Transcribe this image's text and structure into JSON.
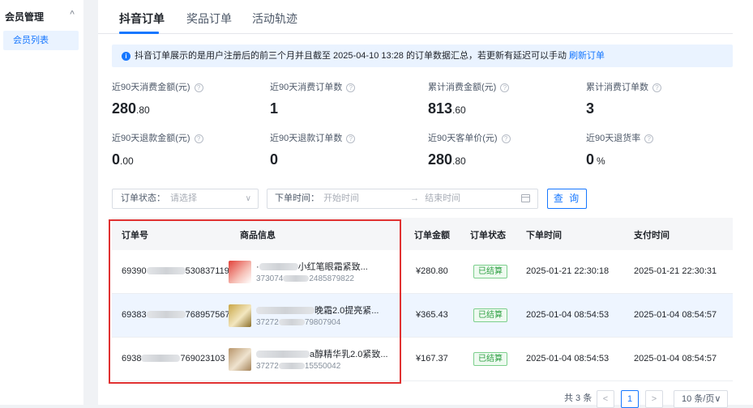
{
  "sidebar": {
    "group_label": "会员管理",
    "group_chevron": "^",
    "items": [
      {
        "label": "会员列表"
      }
    ]
  },
  "tabs": [
    {
      "label": "抖音订单"
    },
    {
      "label": "奖品订单"
    },
    {
      "label": "活动轨迹"
    }
  ],
  "notice": {
    "icon": "i",
    "text": "抖音订单展示的是用户注册后的前三个月并且截至 2025-04-10 13:28 的订单数据汇总，若更新有延迟可以手动 ",
    "link": "刷新订单"
  },
  "stats": [
    {
      "label": "近90天消费金额(元)",
      "int": "280",
      "dec": ".80",
      "unit": ""
    },
    {
      "label": "近90天消费订单数",
      "int": "1",
      "dec": "",
      "unit": ""
    },
    {
      "label": "累计消费金额(元)",
      "int": "813",
      "dec": ".60",
      "unit": ""
    },
    {
      "label": "累计消费订单数",
      "int": "3",
      "dec": "",
      "unit": ""
    },
    {
      "label": "近90天退款金额(元)",
      "int": "0",
      "dec": ".00",
      "unit": ""
    },
    {
      "label": "近90天退款订单数",
      "int": "0",
      "dec": "",
      "unit": ""
    },
    {
      "label": "近90天客单价(元)",
      "int": "280",
      "dec": ".80",
      "unit": ""
    },
    {
      "label": "近90天退货率",
      "int": "0",
      "dec": "",
      "unit": "%"
    }
  ],
  "help_glyph": "?",
  "filters": {
    "status_label": "订单状态：",
    "status_placeholder": "请选择",
    "status_chevron": "∨",
    "time_label": "下单时间：",
    "start_placeholder": "开始时间",
    "arrow": "→",
    "end_placeholder": "结束时间",
    "query_button": "查 询"
  },
  "table": {
    "columns": [
      "订单号",
      "商品信息",
      "订单金额",
      "订单状态",
      "下单时间",
      "支付时间"
    ],
    "rows": [
      {
        "order_prefix": "69390",
        "order_suffix": "530837119",
        "product_prefix": "·",
        "product_name": "小红笔眼霜紧致...",
        "product_id_prefix": "373074",
        "product_id_suffix": "2485879822",
        "amount": "¥280.80",
        "status": "已结算",
        "order_time": "2025-01-21 22:30:18",
        "pay_time": "2025-01-21 22:30:31"
      },
      {
        "order_prefix": "69383",
        "order_suffix": "768957567",
        "product_prefix": "",
        "product_name": "晚霜2.0提亮紧...",
        "product_id_prefix": "37272",
        "product_id_suffix": "79807904",
        "amount": "¥365.43",
        "status": "已结算",
        "order_time": "2025-01-04 08:54:53",
        "pay_time": "2025-01-04 08:54:57"
      },
      {
        "order_prefix": "6938",
        "order_suffix": "769023103",
        "product_prefix": "",
        "product_name": "a醇精华乳2.0紧致...",
        "product_id_prefix": "37272",
        "product_id_suffix": "15550042",
        "amount": "¥167.37",
        "status": "已结算",
        "order_time": "2025-01-04 08:54:53",
        "pay_time": "2025-01-04 08:54:57"
      }
    ]
  },
  "pagination": {
    "total": "共 3 条",
    "prev": "<",
    "current": "1",
    "next": ">",
    "page_size": "10 条/页∨"
  },
  "colors": {
    "accent": "#1677ff",
    "success": "#2ea043",
    "highlight_box": "#e03131"
  }
}
